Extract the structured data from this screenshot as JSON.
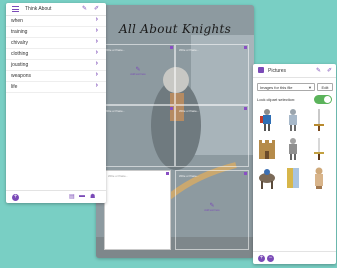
{
  "canvas": {
    "title": "All About Knights",
    "textbox_label": "Write or Paste...",
    "add_text_label": "Add text here"
  },
  "think_about": {
    "title": "Think About",
    "items": [
      {
        "label": "when"
      },
      {
        "label": "training"
      },
      {
        "label": "chivalry"
      },
      {
        "label": "clothing"
      },
      {
        "label": "jousting"
      },
      {
        "label": "weapons"
      },
      {
        "label": "life"
      }
    ]
  },
  "pictures": {
    "title": "Pictures",
    "source_value": "Images for this file",
    "edit_label": "Edit",
    "lock_label": "Lock clipart selection:",
    "lock_on": true,
    "clipart": [
      "knight-icon",
      "knight-icon",
      "sword-icon",
      "castle-icon",
      "knight-icon",
      "sword-icon",
      "horse-icon",
      "shield-icon",
      "knight-icon"
    ]
  },
  "colors": {
    "accent": "#7a4ab7",
    "background": "#79cfc4",
    "toggle_on": "#5bb35b"
  }
}
